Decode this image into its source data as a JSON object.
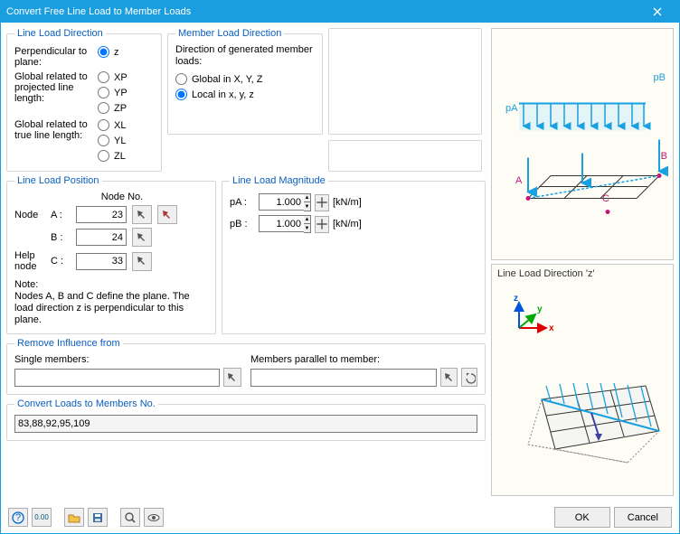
{
  "window": {
    "title": "Convert Free Line Load to Member Loads"
  },
  "lineLoadDirection": {
    "legend": "Line Load Direction",
    "perpendicularLabel": "Perpendicular to plane:",
    "projectedLabel": "Global related to projected line length:",
    "trueLabel": "Global related to true line length:",
    "opts": {
      "z": "z",
      "xp": "XP",
      "yp": "YP",
      "zp": "ZP",
      "xl": "XL",
      "yl": "YL",
      "zl": "ZL"
    },
    "selected": "z"
  },
  "memberLoadDirection": {
    "legend": "Member Load Direction",
    "intro": "Direction of generated member loads:",
    "global": "Global in X, Y, Z",
    "local": "Local in x, y, z",
    "selected": "local"
  },
  "lineLoadPosition": {
    "legend": "Line Load Position",
    "nodeNoHeader": "Node No.",
    "nodeLabel": "Node",
    "helpNodeLabel": "Help node",
    "rows": {
      "a": "A :",
      "b": "B :",
      "c": "C :"
    },
    "values": {
      "a": "23",
      "b": "24",
      "c": "33"
    },
    "note": "Note:\nNodes A, B and C define the plane. The load direction z is perpendicular to this plane."
  },
  "lineLoadMagnitude": {
    "legend": "Line Load Magnitude",
    "pa": "pA :",
    "pb": "pB :",
    "values": {
      "pa": "1.000",
      "pb": "1.000"
    },
    "unit": "[kN/m]"
  },
  "removeInfluence": {
    "legend": "Remove Influence from",
    "singleMembers": "Single members:",
    "parallelMembers": "Members parallel to member:",
    "singleValue": "",
    "parallelValue": ""
  },
  "convertLoads": {
    "legend": "Convert Loads to Members No.",
    "value": "83,88,92,95,109"
  },
  "preview": {
    "topLabels": {
      "pa": "pA",
      "pb": "pB",
      "a": "A",
      "b": "B",
      "c": "C"
    },
    "bottomTitle": "Line Load Direction 'z'",
    "axes": {
      "x": "x",
      "y": "y",
      "z": "z"
    }
  },
  "footer": {
    "ok": "OK",
    "cancel": "Cancel"
  },
  "icons": {
    "help": "?",
    "details": "0.00",
    "open": "📂",
    "save": "💾",
    "zoom": "🔍",
    "eye": "👁"
  }
}
